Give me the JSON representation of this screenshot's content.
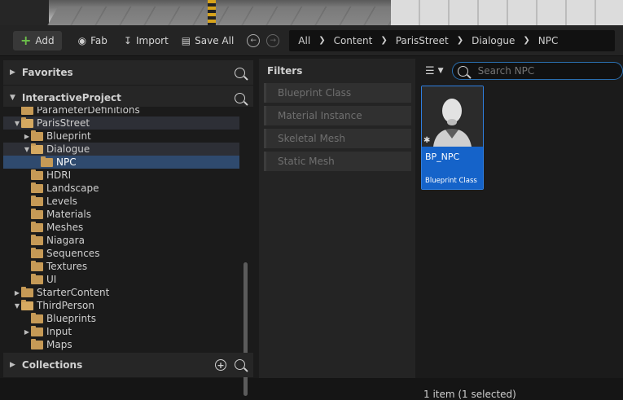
{
  "toolbar": {
    "add_label": "Add",
    "fab_label": "Fab",
    "import_label": "Import",
    "save_all_label": "Save All"
  },
  "breadcrumb": [
    "All",
    "Content",
    "ParisStreet",
    "Dialogue",
    "NPC"
  ],
  "favorites": {
    "title": "Favorites"
  },
  "project": {
    "title": "InteractiveProject"
  },
  "tree": [
    {
      "label": "ParameterDefinitions",
      "indent": 1,
      "state": "none"
    },
    {
      "label": "ParisStreet",
      "indent": 1,
      "state": "expanded"
    },
    {
      "label": "Blueprint",
      "indent": 2,
      "state": "collapsed"
    },
    {
      "label": "Dialogue",
      "indent": 2,
      "state": "expanded"
    },
    {
      "label": "NPC",
      "indent": 3,
      "state": "none"
    },
    {
      "label": "HDRI",
      "indent": 2,
      "state": "none"
    },
    {
      "label": "Landscape",
      "indent": 2,
      "state": "none"
    },
    {
      "label": "Levels",
      "indent": 2,
      "state": "none"
    },
    {
      "label": "Materials",
      "indent": 2,
      "state": "none"
    },
    {
      "label": "Meshes",
      "indent": 2,
      "state": "none"
    },
    {
      "label": "Niagara",
      "indent": 2,
      "state": "none"
    },
    {
      "label": "Sequences",
      "indent": 2,
      "state": "none"
    },
    {
      "label": "Textures",
      "indent": 2,
      "state": "none"
    },
    {
      "label": "UI",
      "indent": 2,
      "state": "none"
    },
    {
      "label": "StarterContent",
      "indent": 1,
      "state": "collapsed"
    },
    {
      "label": "ThirdPerson",
      "indent": 1,
      "state": "expanded"
    },
    {
      "label": "Blueprints",
      "indent": 2,
      "state": "none"
    },
    {
      "label": "Input",
      "indent": 2,
      "state": "collapsed"
    },
    {
      "label": "Maps",
      "indent": 2,
      "state": "none"
    }
  ],
  "collections": {
    "title": "Collections"
  },
  "filters": {
    "title": "Filters",
    "items": [
      "Blueprint Class",
      "Material Instance",
      "Skeletal Mesh",
      "Static Mesh"
    ]
  },
  "search": {
    "placeholder": "Search NPC"
  },
  "asset": {
    "name": "BP_NPC",
    "class": "Blueprint Class"
  },
  "status": {
    "text": "1 item (1 selected)"
  },
  "colors": {
    "accent": "#1563c9",
    "selection": "#2f4a6e",
    "add_icon": "#6cc04a"
  }
}
